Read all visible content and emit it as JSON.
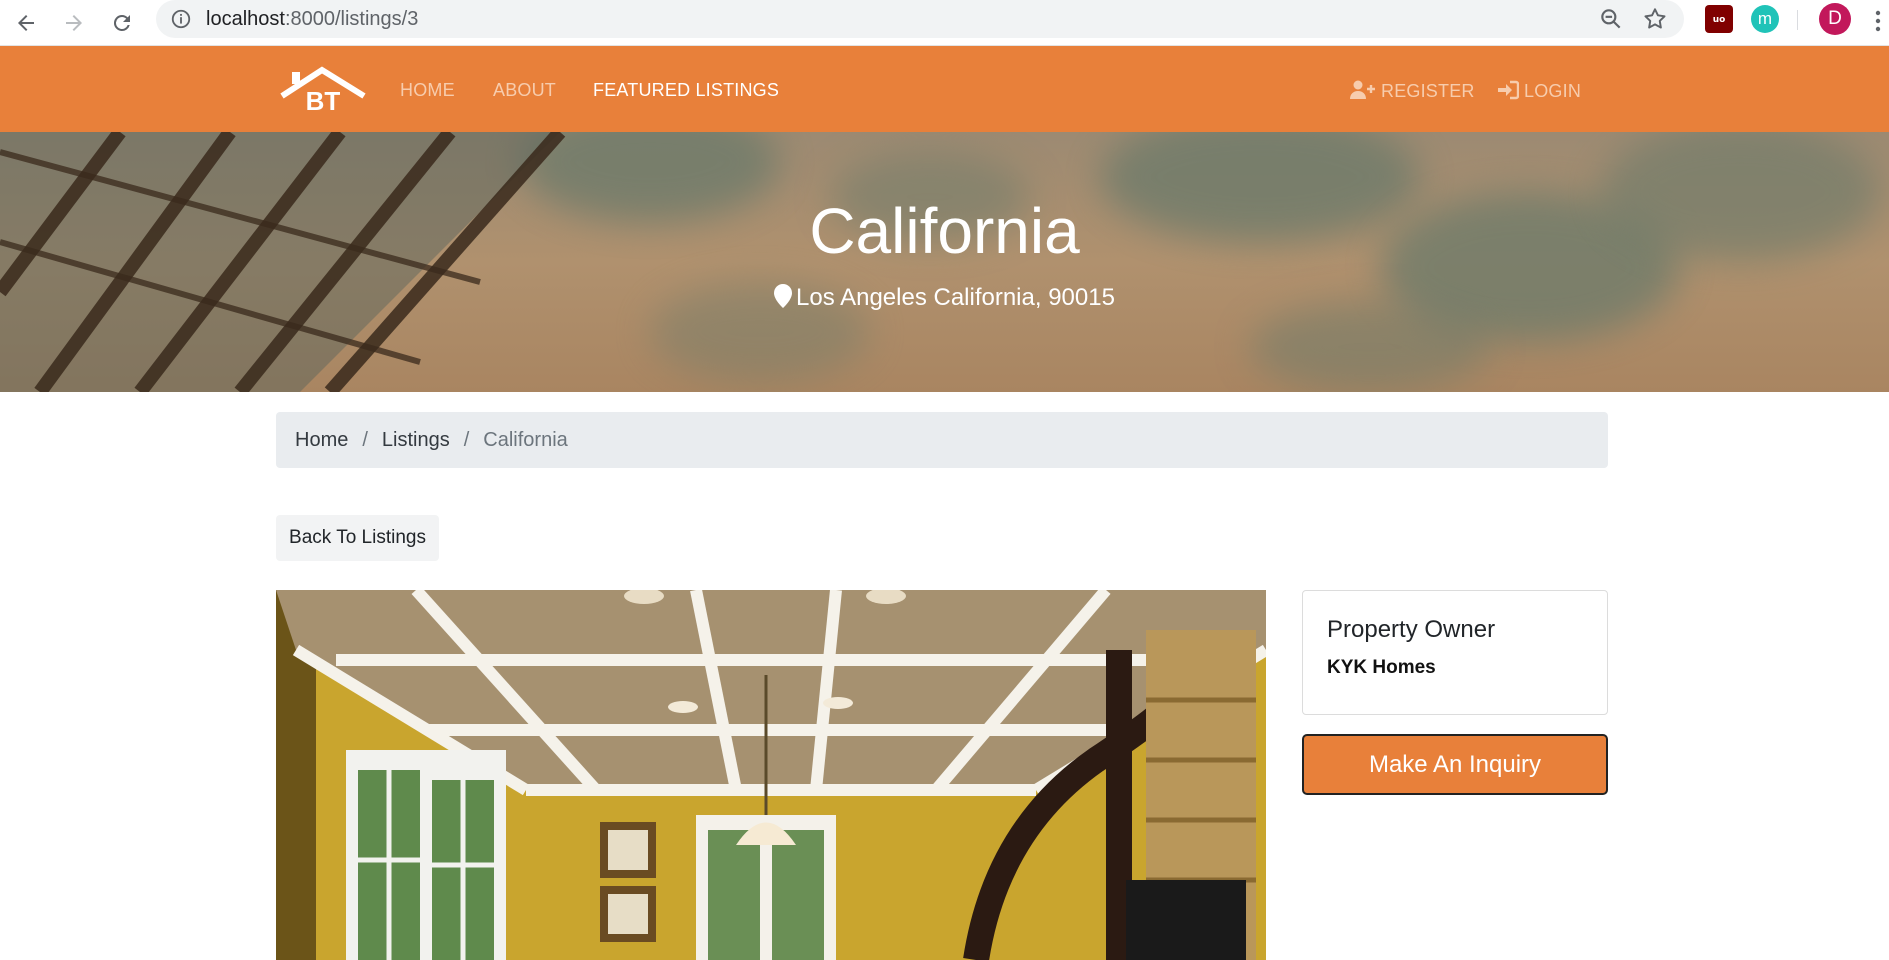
{
  "browser": {
    "url_host": "localhost",
    "url_path": ":8000/listings/3",
    "profile_initial": "D",
    "extension_m_initial": "m"
  },
  "navbar": {
    "logo_text": "BT",
    "links": [
      {
        "label": "HOME"
      },
      {
        "label": "ABOUT"
      },
      {
        "label": "FEATURED LISTINGS"
      }
    ],
    "register_label": "REGISTER",
    "login_label": "LOGIN",
    "colors": {
      "bar": "#e8803a",
      "link": "#f7ccad",
      "active": "#ffffff"
    }
  },
  "hero": {
    "title": "California",
    "address": "Los Angeles California, 90015"
  },
  "breadcrumb": {
    "items": [
      {
        "label": "Home"
      },
      {
        "label": "Listings"
      }
    ],
    "current": "California",
    "separator": "/"
  },
  "back_button": {
    "label": "Back To Listings"
  },
  "owner": {
    "heading": "Property Owner",
    "name": "KYK Homes"
  },
  "inquiry_button": {
    "label": "Make An Inquiry"
  }
}
